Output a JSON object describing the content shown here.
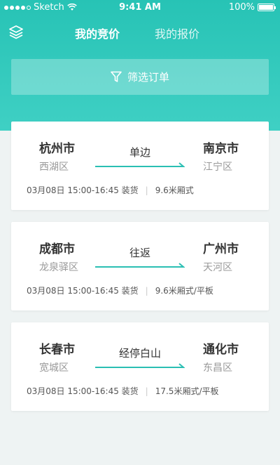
{
  "status_bar": {
    "carrier": "Sketch",
    "time": "9:41 AM",
    "battery": "100%"
  },
  "nav": {
    "tabs": [
      {
        "label": "我的竞价",
        "active": true
      },
      {
        "label": "我的报价",
        "active": false
      }
    ]
  },
  "filter": {
    "label": "筛选订单"
  },
  "orders": [
    {
      "from_city": "杭州市",
      "from_district": "西湖区",
      "route_type": "单边",
      "to_city": "南京市",
      "to_district": "江宁区",
      "time": "03月08日 15:00-16:45 装货",
      "vehicle": "9.6米厢式"
    },
    {
      "from_city": "成都市",
      "from_district": "龙泉驿区",
      "route_type": "往返",
      "to_city": "广州市",
      "to_district": "天河区",
      "time": "03月08日 15:00-16:45 装货",
      "vehicle": "9.6米厢式/平板"
    },
    {
      "from_city": "长春市",
      "from_district": "宽城区",
      "route_type": "经停白山",
      "to_city": "通化市",
      "to_district": "东昌区",
      "time": "03月08日 15:00-16:45 装货",
      "vehicle": "17.5米厢式/平板"
    }
  ],
  "colors": {
    "header_top": "#27c3b5",
    "header_bottom": "#3fd0c4",
    "route_line": "#2bbfb3"
  }
}
